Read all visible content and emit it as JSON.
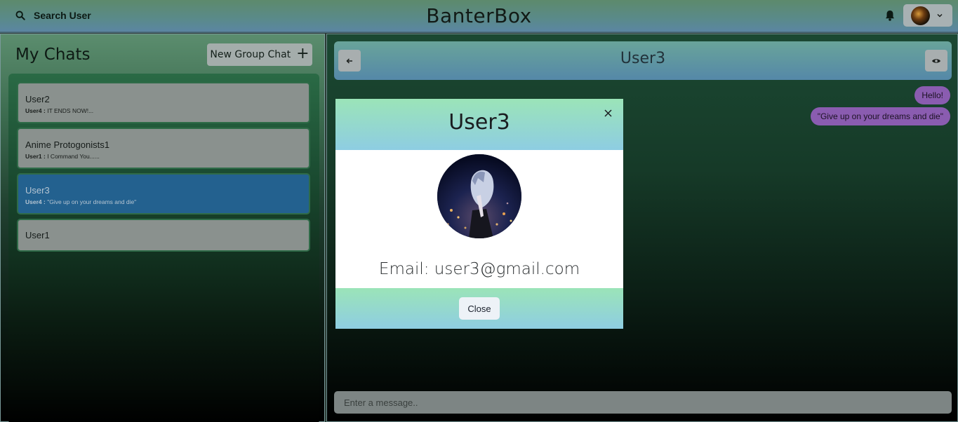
{
  "topbar": {
    "search_label": "Search User",
    "app_title": "BanterBox"
  },
  "left": {
    "heading": "My Chats",
    "new_group_label": "New Group Chat",
    "new_group_icon": "+",
    "chats": [
      {
        "name": "User2",
        "sender": "User4 :",
        "preview": "IT ENDS NOW!...",
        "active": false
      },
      {
        "name": "Anime Protogonists1",
        "sender": "User1 :",
        "preview": "I Command You......",
        "active": false
      },
      {
        "name": "User3",
        "sender": "User4 :",
        "preview": "\"Give up on your dreams and die\"",
        "active": true
      },
      {
        "name": "User1",
        "sender": "",
        "preview": "",
        "active": false
      }
    ]
  },
  "chat": {
    "title": "User3",
    "messages": [
      "Hello!",
      "\"Give up on your dreams and die\""
    ],
    "input_placeholder": "Enter a message.."
  },
  "modal": {
    "title": "User3",
    "close_icon": "×",
    "email": "Email: user3@gmail.com",
    "close_button": "Close"
  },
  "colors": {
    "active_chat": "#23618f",
    "bubble": "#8a5cb0",
    "modal_gradient_top": "#9be4b8",
    "modal_gradient_bottom": "#8ecde2"
  }
}
